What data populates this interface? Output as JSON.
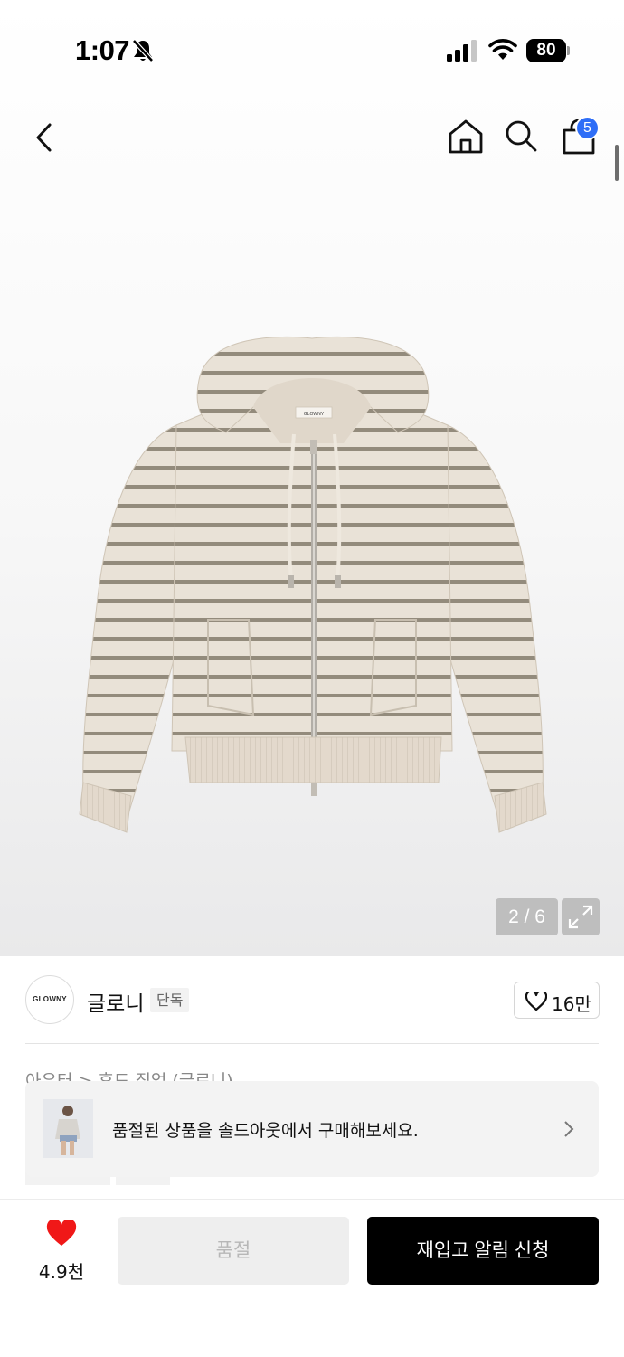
{
  "status_bar": {
    "time": "1:07",
    "battery_level": "80",
    "icons": [
      "bell-off-icon",
      "cellular-signal-icon",
      "wifi-icon",
      "battery-icon"
    ]
  },
  "nav": {
    "icons": [
      "back-arrow-icon",
      "home-icon",
      "search-icon",
      "shopping-bag-icon"
    ],
    "cart_count": "5"
  },
  "gallery": {
    "counter": "2 / 6",
    "current_image": 2,
    "total_images": 6,
    "garment_label": "GLOWNY"
  },
  "brand": {
    "logo_text": "GLOWNY",
    "name": "글로니",
    "tag": "단독",
    "like_count": "16만"
  },
  "breadcrumb": "아우터 > 후드 집업 (글로니)",
  "soldout_banner": {
    "text": "품절된 상품을 솔드아웃에서 구매해보세요."
  },
  "bottom_bar": {
    "wish_count": "4.9천",
    "soldout_label": "품절",
    "restock_label": "재입고 알림 신청"
  },
  "colors": {
    "accent_blue": "#2f6ef7",
    "heart_red": "#f01818",
    "primary_button": "#000000",
    "disabled_button": "#eeeeee",
    "garment_base": "#e6ded3",
    "garment_stripe": "#8f8778"
  }
}
